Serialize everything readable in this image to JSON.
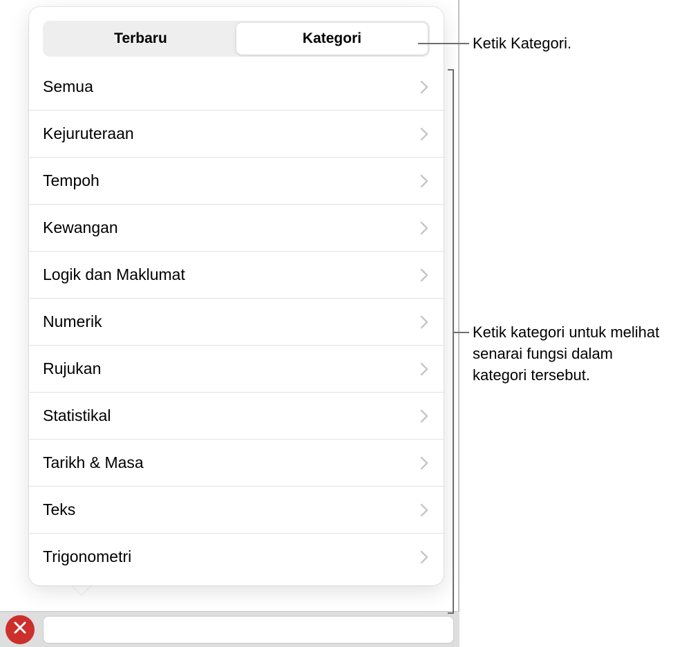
{
  "tabs": {
    "recent": "Terbaru",
    "category": "Kategori"
  },
  "categories": [
    "Semua",
    "Kejuruteraan",
    "Tempoh",
    "Kewangan",
    "Logik dan Maklumat",
    "Numerik",
    "Rujukan",
    "Statistikal",
    "Tarikh & Masa",
    "Teks",
    "Trigonometri"
  ],
  "callouts": {
    "tap_category_tab": "Ketik Kategori.",
    "tap_category_list": "Ketik kategori untuk melihat senarai fungsi dalam kategori tersebut."
  }
}
